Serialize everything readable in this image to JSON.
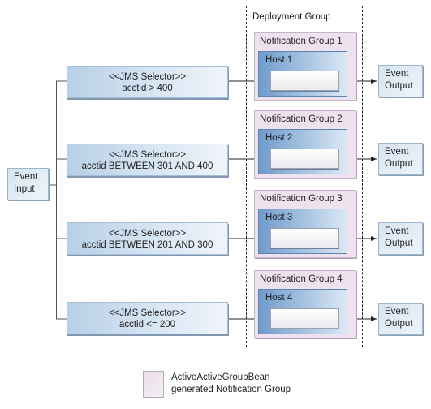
{
  "diagram": {
    "input": {
      "line1": "Event",
      "line2": "Input"
    },
    "selectors": [
      {
        "stereotype": "<<JMS Selector>>",
        "expression": "acctid > 400"
      },
      {
        "stereotype": "<<JMS Selector>>",
        "expression": "acctid BETWEEN 301 AND 400"
      },
      {
        "stereotype": "<<JMS Selector>>",
        "expression": "acctid BETWEEN 201 AND 300"
      },
      {
        "stereotype": "<<JMS Selector>>",
        "expression": "acctid <= 200"
      }
    ],
    "deployment_group": {
      "label": "Deployment Group"
    },
    "notification_groups": [
      {
        "label": "Notification Group 1",
        "host": "Host 1"
      },
      {
        "label": "Notification Group 2",
        "host": "Host 2"
      },
      {
        "label": "Notification Group 3",
        "host": "Host 3"
      },
      {
        "label": "Notification Group 4",
        "host": "Host 4"
      }
    ],
    "outputs": [
      {
        "line1": "Event",
        "line2": "Output"
      },
      {
        "line1": "Event",
        "line2": "Output"
      },
      {
        "line1": "Event",
        "line2": "Output"
      },
      {
        "line1": "Event",
        "line2": "Output"
      }
    ],
    "legend": {
      "line1": "ActiveActiveGroupBean",
      "line2": "generated Notification Group"
    },
    "colors": {
      "selector_fill": "#c9dcee",
      "notification_group_fill": "#eee2ee",
      "host_fill": "#8fb2d8",
      "line": "#333333"
    }
  }
}
